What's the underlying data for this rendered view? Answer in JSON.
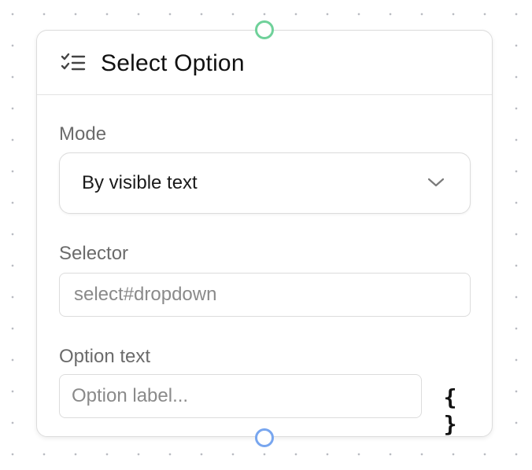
{
  "node": {
    "title": "Select Option",
    "icon": "checklist-icon"
  },
  "mode": {
    "label": "Mode",
    "selected": "By visible text",
    "icon": "chevron-down-icon"
  },
  "selector": {
    "label": "Selector",
    "placeholder": "select#dropdown"
  },
  "option_text": {
    "label": "Option text",
    "placeholder": "Option label...",
    "expression_button": "{ }"
  },
  "handles": {
    "input_color": "#6fd19a",
    "output_color": "#78a6ef"
  }
}
